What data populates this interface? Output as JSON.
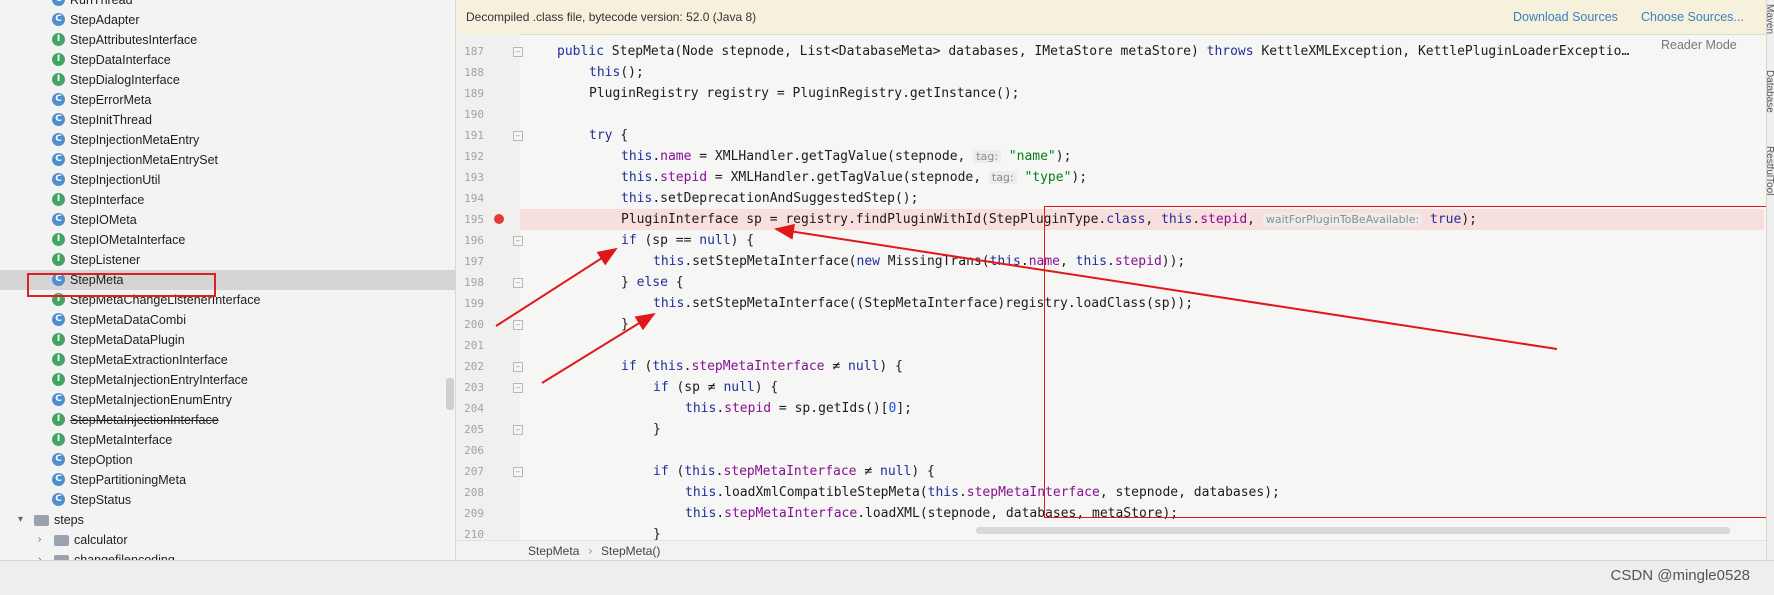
{
  "tree": {
    "items": [
      {
        "label": "RunThread",
        "kind": "c",
        "clipped": true
      },
      {
        "label": "StepAdapter",
        "kind": "c"
      },
      {
        "label": "StepAttributesInterface",
        "kind": "i"
      },
      {
        "label": "StepDataInterface",
        "kind": "i"
      },
      {
        "label": "StepDialogInterface",
        "kind": "i"
      },
      {
        "label": "StepErrorMeta",
        "kind": "c"
      },
      {
        "label": "StepInitThread",
        "kind": "c"
      },
      {
        "label": "StepInjectionMetaEntry",
        "kind": "c"
      },
      {
        "label": "StepInjectionMetaEntrySet",
        "kind": "c"
      },
      {
        "label": "StepInjectionUtil",
        "kind": "c"
      },
      {
        "label": "StepInterface",
        "kind": "i"
      },
      {
        "label": "StepIOMeta",
        "kind": "c"
      },
      {
        "label": "StepIOMetaInterface",
        "kind": "i"
      },
      {
        "label": "StepListener",
        "kind": "i"
      },
      {
        "label": "StepMeta",
        "kind": "c",
        "selected": true
      },
      {
        "label": "StepMetaChangeListenerInterface",
        "kind": "i"
      },
      {
        "label": "StepMetaDataCombi",
        "kind": "c"
      },
      {
        "label": "StepMetaDataPlugin",
        "kind": "i"
      },
      {
        "label": "StepMetaExtractionInterface",
        "kind": "i"
      },
      {
        "label": "StepMetaInjectionEntryInterface",
        "kind": "i"
      },
      {
        "label": "StepMetaInjectionEnumEntry",
        "kind": "c"
      },
      {
        "label": "StepMetaInjectionInterface",
        "kind": "i",
        "strike": true
      },
      {
        "label": "StepMetaInterface",
        "kind": "i"
      },
      {
        "label": "StepOption",
        "kind": "c"
      },
      {
        "label": "StepPartitioningMeta",
        "kind": "c"
      },
      {
        "label": "StepStatus",
        "kind": "c"
      }
    ],
    "folders": [
      {
        "label": "steps",
        "level": 1,
        "expanded": true
      },
      {
        "label": "calculator",
        "level": 2,
        "expanded": false
      },
      {
        "label": "changefilencoding",
        "level": 2,
        "expanded": false,
        "clipped": true
      }
    ]
  },
  "editor": {
    "banner_text": "Decompiled .class file, bytecode version: 52.0 (Java 8)",
    "download_sources": "Download Sources",
    "choose_sources": "Choose Sources...",
    "reader_mode": "Reader Mode",
    "line_numbers": [
      "187",
      "188",
      "189",
      "190",
      "191",
      "192",
      "193",
      "194",
      "195",
      "196",
      "197",
      "198",
      "199",
      "200",
      "201",
      "202",
      "203",
      "204",
      "205",
      "206",
      "207",
      "208",
      "209",
      "210"
    ],
    "hints": {
      "tag1": "tag:",
      "tag2": "tag:",
      "wait": "waitForPluginToBeAvailable:"
    }
  },
  "breadcrumb": {
    "class": "StepMeta",
    "method": "StepMeta()"
  },
  "right_tabs": [
    "Maven",
    "Database",
    "RestfulTool"
  ],
  "watermark": "CSDN @mingle0528",
  "colors": {
    "annotation_red": "#e01818",
    "breakpoint": "#e23b3b",
    "keyword": "#1f2e9b",
    "field": "#871094",
    "string": "#067d17",
    "link": "#3a7fc1"
  }
}
